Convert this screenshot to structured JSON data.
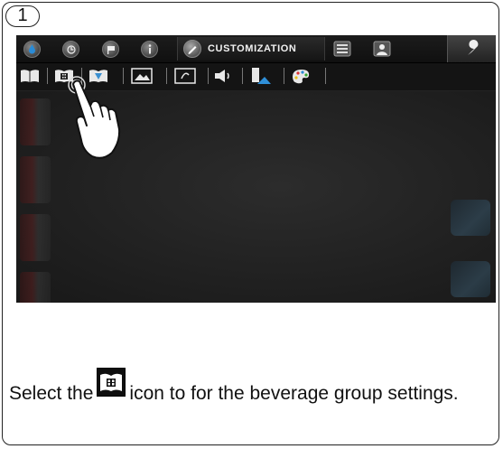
{
  "step": {
    "number": "1"
  },
  "device": {
    "topbar": {
      "icons": [
        "water-drop-icon",
        "clock-icon",
        "flag-icon",
        "info-icon",
        "customization-icon",
        "keypad-icon",
        "user-icon",
        "wrench-icon"
      ],
      "active_tab_label": "CUSTOMIZATION"
    },
    "toolbar": {
      "icons": [
        "book-icon",
        "beverage-group-icon",
        "book-alt-icon",
        "picture-icon",
        "screensaver-icon",
        "speaker-icon",
        "cup-icon",
        "palette-icon"
      ],
      "highlighted": "beverage-group-icon"
    }
  },
  "instruction": {
    "before_icon": "Select the",
    "after_icon": "icon to for the beverage group settings."
  }
}
